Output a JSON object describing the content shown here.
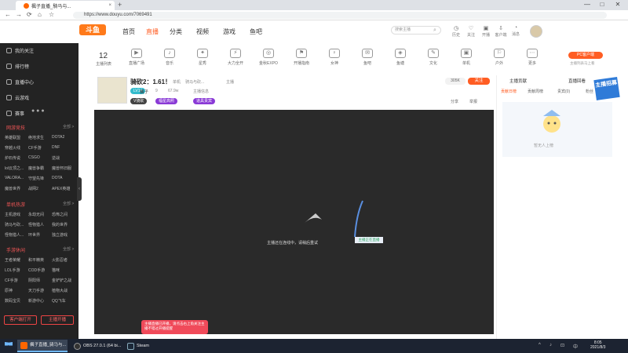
{
  "browser": {
    "tab_title": "楓子直播_騎马与...",
    "url": "https://www.douyu.com/7069491",
    "new_tab": "+",
    "win_controls": [
      "—",
      "□",
      "✕"
    ]
  },
  "header": {
    "logo": "斗鱼",
    "nav": [
      "首页",
      "直播",
      "分类",
      "视频",
      "游戏",
      "鱼吧"
    ],
    "nav_active": "直播",
    "search_placeholder": "搜索主播",
    "icons": [
      {
        "label": "历史",
        "icon": "history-icon"
      },
      {
        "label": "关注",
        "icon": "heart-icon"
      },
      {
        "label": "开播",
        "icon": "camera-icon"
      },
      {
        "label": "客户端",
        "icon": "download-icon"
      },
      {
        "label": "消息",
        "icon": "bell-icon"
      }
    ]
  },
  "sidebar": {
    "top_items": [
      "我的关注",
      "排行榜",
      "直播中心",
      "云游戏",
      "赛事"
    ],
    "section1_title": "网游竞技",
    "section1_more": "全部 >",
    "section1_games": [
      "英雄联盟",
      "绝地求生",
      "DOTA2",
      "穿越火线",
      "CF手游",
      "DNF",
      "炉石传说",
      "CSGO",
      "逆战",
      "lol云顶之...",
      "魔兽争霸",
      "魔兽怀旧服",
      "VALORA...",
      "守望先锋",
      "DOTA",
      "魔兽世界",
      "战网2",
      "APEX英雄"
    ],
    "section2_title": "单机热游",
    "section2_more": "全部 >",
    "section2_games": [
      "主机游戏",
      "永劫无间",
      "恐怖之间",
      "骑马与砍...",
      "怪物猎人",
      "我的世界",
      "怪物猎人...",
      "环世界",
      "独立游戏"
    ],
    "section3_title": "手游休闲",
    "section3_more": "全部 >",
    "section3_games": [
      "王者荣耀",
      "和平精英",
      "火影忍者",
      "LOL手游",
      "COD手游",
      "猫咪",
      "CF手游",
      "阴阳师",
      "金铲铲之战",
      "原神",
      "天刀手游",
      "植物大战",
      "数码宝贝",
      "新游中心",
      "QQ飞车"
    ],
    "btn_client": "客户端打开",
    "btn_open": "主播开播",
    "collapse": "‹"
  },
  "category_strip": {
    "follow_count": "12",
    "follow_label": "主播列表",
    "items": [
      "直播广场",
      "音乐",
      "星秀",
      "大力全开",
      "金秋EXPO",
      "开播指南",
      "女神",
      "鱼吧",
      "鱼塘",
      "文化",
      "单机",
      "户外",
      "更多"
    ],
    "pc_button": "PC客户端",
    "pc_sub": "主播列表马上看"
  },
  "room": {
    "title": "骑砍2：1.61！",
    "meta": [
      "单机",
      "骑马与砍...",
      "主播"
    ],
    "streamer": "楓子",
    "level_badge": "LV14",
    "stats": [
      "9",
      "67.9w",
      "主播信息"
    ],
    "tags": [
      "V骑砍",
      "福星高照",
      "道具贵宾"
    ],
    "room_id": "305K",
    "follow_btn": "关注",
    "share": "分享",
    "report": "举报"
  },
  "player": {
    "loading_text": "主播还在连线中，请稍后重试",
    "hint_box": "主播正在直播",
    "toast": "主播直播已开播，请点击右上角关注主播不错过开播提醒"
  },
  "rightpanel": {
    "hd1": "主播贡献",
    "hd2": "直播回看",
    "tabs": [
      "贡献日榜",
      "贡献周榜",
      "贵宾(0)",
      "粉丝"
    ],
    "banner": "主播招募",
    "empty_text": "暂无人上榜"
  },
  "taskbar": {
    "items": [
      "楓子直播_骑马与...",
      "OBS 27.0.1 (64 bi...",
      "Steam"
    ],
    "time": "8:05",
    "date": "2021/8/3",
    "tray": [
      "^",
      "♪",
      "⊡",
      "中"
    ]
  }
}
